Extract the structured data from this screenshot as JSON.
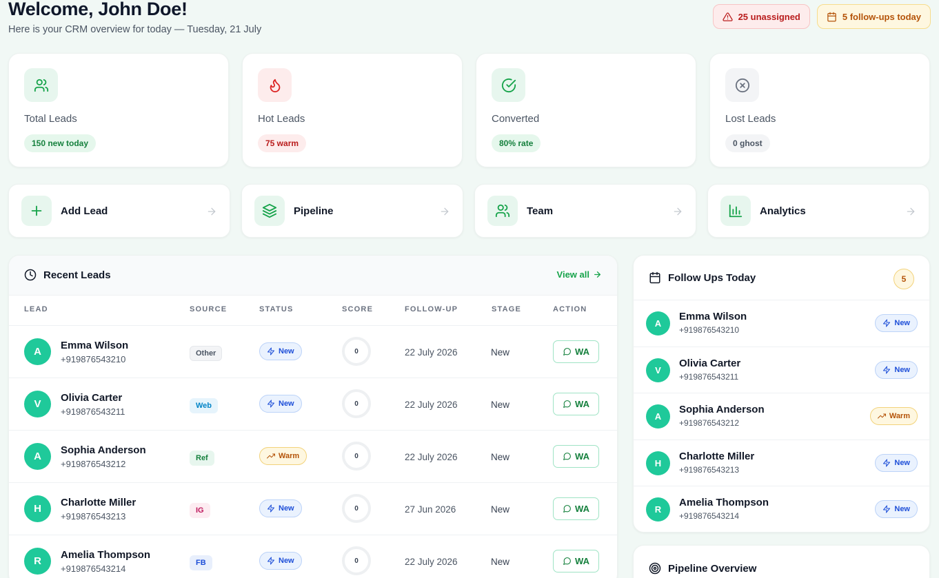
{
  "header": {
    "welcome": "Welcome, John Doe!",
    "subtitle": "Here is your CRM overview for today — Tuesday, 21 July",
    "alerts": [
      {
        "label": "25 unassigned",
        "icon": "warning-triangle-icon"
      },
      {
        "label": "5 follow-ups today",
        "icon": "calendar-icon"
      }
    ]
  },
  "stats": [
    {
      "label": "Total Leads",
      "pill": "150 new today",
      "icon": "users-icon",
      "tint": "#e7f6ee",
      "color": "#16a34a",
      "pill_bg": "#e5f7ec",
      "pill_color": "#15803d"
    },
    {
      "label": "Hot Leads",
      "pill": "75 warm",
      "icon": "flame-icon",
      "tint": "#fdecec",
      "color": "#dc2626",
      "pill_bg": "#fdecec",
      "pill_color": "#b91c1c"
    },
    {
      "label": "Converted",
      "pill": "80% rate",
      "icon": "check-circle-icon",
      "tint": "#e7f6ee",
      "color": "#16a34a",
      "pill_bg": "#e5f7ec",
      "pill_color": "#15803d"
    },
    {
      "label": "Lost Leads",
      "pill": "0 ghost",
      "icon": "x-circle-icon",
      "tint": "#f3f4f6",
      "color": "#6b7280",
      "pill_bg": "#f3f4f6",
      "pill_color": "#4b5563"
    }
  ],
  "actions": [
    {
      "label": "Add Lead",
      "icon": "plus-icon"
    },
    {
      "label": "Pipeline",
      "icon": "layers-icon"
    },
    {
      "label": "Team",
      "icon": "users-icon"
    },
    {
      "label": "Analytics",
      "icon": "bar-chart-icon"
    }
  ],
  "recent": {
    "title": "Recent Leads",
    "view_all": "View all",
    "columns": [
      "LEAD",
      "SOURCE",
      "STATUS",
      "SCORE",
      "FOLLOW-UP",
      "STAGE",
      "ACTION"
    ],
    "rows": [
      {
        "initial": "A",
        "name": "Emma Wilson",
        "phone": "+919876543210",
        "source": "Other",
        "status": "New",
        "score": "0",
        "followup": "22 July 2026",
        "stage": "New",
        "action": "WA"
      },
      {
        "initial": "V",
        "name": "Olivia Carter",
        "phone": "+919876543211",
        "source": "Web",
        "status": "New",
        "score": "0",
        "followup": "22 July 2026",
        "stage": "New",
        "action": "WA"
      },
      {
        "initial": "A",
        "name": "Sophia Anderson",
        "phone": "+919876543212",
        "source": "Ref",
        "status": "Warm",
        "score": "0",
        "followup": "22 July 2026",
        "stage": "New",
        "action": "WA"
      },
      {
        "initial": "H",
        "name": "Charlotte Miller",
        "phone": "+919876543213",
        "source": "IG",
        "status": "New",
        "score": "0",
        "followup": "27 Jun 2026",
        "stage": "New",
        "action": "WA"
      },
      {
        "initial": "R",
        "name": "Amelia Thompson",
        "phone": "+919876543214",
        "source": "FB",
        "status": "New",
        "score": "0",
        "followup": "22 July 2026",
        "stage": "New",
        "action": "WA"
      }
    ]
  },
  "source_colors": {
    "Other": {
      "bg": "#f3f4f6",
      "fg": "#4b5563",
      "border": "#e5e7eb"
    },
    "Web": {
      "bg": "#e6f4fc",
      "fg": "#0284c7",
      "border": "#e6f4fc"
    },
    "Ref": {
      "bg": "#e7f6ee",
      "fg": "#15803d",
      "border": "#e7f6ee"
    },
    "IG": {
      "bg": "#fdecf1",
      "fg": "#be185d",
      "border": "#fdecf1"
    },
    "FB": {
      "bg": "#e8effc",
      "fg": "#1d4ed8",
      "border": "#e8effc"
    }
  },
  "followups": {
    "title": "Follow Ups Today",
    "count": "5",
    "items": [
      {
        "initial": "A",
        "name": "Emma Wilson",
        "phone": "+919876543210",
        "status": "New"
      },
      {
        "initial": "V",
        "name": "Olivia Carter",
        "phone": "+919876543211",
        "status": "New"
      },
      {
        "initial": "A",
        "name": "Sophia Anderson",
        "phone": "+919876543212",
        "status": "Warm"
      },
      {
        "initial": "H",
        "name": "Charlotte Miller",
        "phone": "+919876543213",
        "status": "New"
      },
      {
        "initial": "R",
        "name": "Amelia Thompson",
        "phone": "+919876543214",
        "status": "New"
      }
    ]
  },
  "pipeline": {
    "title": "Pipeline Overview"
  }
}
